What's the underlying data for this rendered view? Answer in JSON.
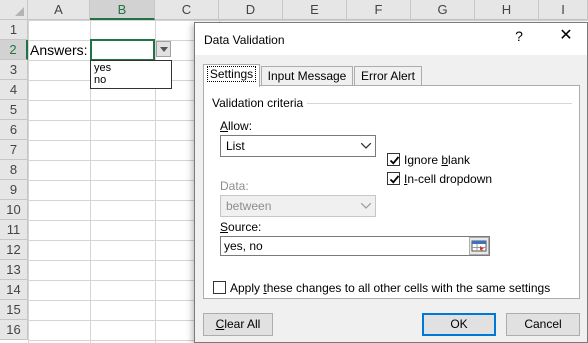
{
  "sheet": {
    "columns": [
      "A",
      "B",
      "C",
      "D",
      "E",
      "F",
      "G",
      "H",
      "I"
    ],
    "rows": [
      "1",
      "2",
      "3",
      "4",
      "5",
      "6",
      "7",
      "8",
      "9",
      "10",
      "11",
      "12",
      "13",
      "14",
      "15",
      "16"
    ],
    "selected_column": "B",
    "selected_row": "2",
    "cell_a2": "Answers:",
    "dropdown_items": [
      "yes",
      "no"
    ]
  },
  "dialog": {
    "title": "Data Validation",
    "help": "?",
    "close": "✕",
    "tabs": [
      {
        "label": "Settings",
        "active": true
      },
      {
        "label": "Input Message",
        "active": false
      },
      {
        "label": "Error Alert",
        "active": false
      }
    ],
    "group_label": "Validation criteria",
    "allow": {
      "label_u": "A",
      "label_rest": "llow:",
      "value": "List"
    },
    "data": {
      "label": "Data:",
      "value": "between"
    },
    "source": {
      "label_u": "S",
      "label_rest": "ource:",
      "value": "yes, no"
    },
    "ignore_blank": {
      "label_pre": "Ignore ",
      "label_u": "b",
      "label_post": "lank",
      "checked": true
    },
    "in_cell_dropdown": {
      "label_u": "I",
      "label_rest": "n-cell dropdown",
      "checked": true
    },
    "apply_all": {
      "label_pre": "Apply ",
      "label_u": "t",
      "label_post": "hese changes to all other cells with the same settings",
      "checked": false
    },
    "clear_all": {
      "label_u": "C",
      "label_rest": "lear All"
    },
    "ok": "OK",
    "cancel": "Cancel"
  },
  "colors": {
    "excel_green": "#217346",
    "focus_blue": "#0078d7"
  }
}
